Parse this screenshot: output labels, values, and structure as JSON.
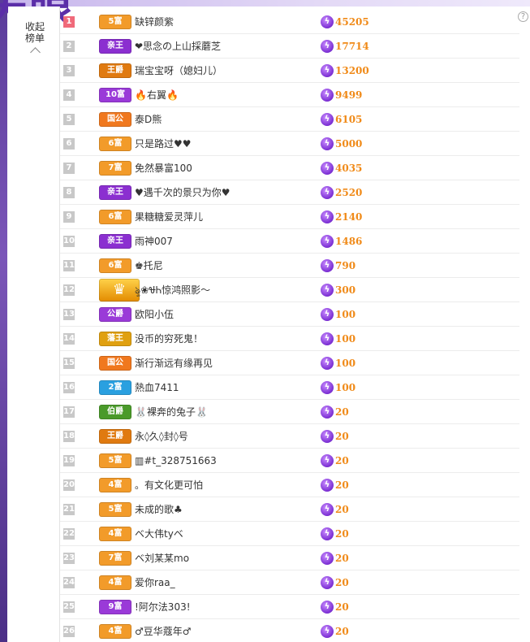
{
  "sidebar": {
    "collapse_label_line1": "收起",
    "collapse_label_line2": "榜单"
  },
  "help_icon": "?",
  "bolt_glyph": "ϟ",
  "brand_glyph": "天眼",
  "rows": [
    {
      "rank": "1",
      "badge": "5富",
      "badge_color": "#f29b2a",
      "name": "缺锌颜紫",
      "value": "45205"
    },
    {
      "rank": "2",
      "badge": "亲王",
      "badge_color": "#8b2fd0",
      "name": "❤思念の上山採蘑芝",
      "value": "17714"
    },
    {
      "rank": "3",
      "badge": "王爵",
      "badge_color": "#e07a10",
      "name": "瑞宝宝呀（媳妇儿）",
      "value": "13200"
    },
    {
      "rank": "4",
      "badge": "10富",
      "badge_color": "#9a3ad8",
      "name": "🔥右翼🔥",
      "value": "9499"
    },
    {
      "rank": "5",
      "badge": "国公",
      "badge_color": "#f0781e",
      "name": "泰D熊",
      "value": "6105"
    },
    {
      "rank": "6",
      "badge": "6富",
      "badge_color": "#f29b2a",
      "name": "只是路过♥♥",
      "value": "5000"
    },
    {
      "rank": "7",
      "badge": "7富",
      "badge_color": "#f29b2a",
      "name": "免然暴富100",
      "value": "4035"
    },
    {
      "rank": "8",
      "badge": "亲王",
      "badge_color": "#8b2fd0",
      "name": "♥遇千次的景只为你♥",
      "value": "2520"
    },
    {
      "rank": "9",
      "badge": "6富",
      "badge_color": "#f29b2a",
      "name": "果糖糖爱灵萍儿",
      "value": "2140"
    },
    {
      "rank": "10",
      "badge": "亲王",
      "badge_color": "#8b2fd0",
      "name": "雨神007",
      "value": "1486"
    },
    {
      "rank": "11",
      "badge": "6富",
      "badge_color": "#f29b2a",
      "name": "♚托尼",
      "value": "790"
    },
    {
      "rank": "12",
      "badge": "",
      "badge_color": "#f0a020",
      "name": "ৡ❀ᏠᏂ惊鸿照影～",
      "value": "300"
    },
    {
      "rank": "13",
      "badge": "公爵",
      "badge_color": "#9a3ad8",
      "name": "欧阳小伍",
      "value": "100"
    },
    {
      "rank": "14",
      "badge": "藩王",
      "badge_color": "#e0a010",
      "name": "没币的穷死鬼！",
      "value": "100"
    },
    {
      "rank": "15",
      "badge": "国公",
      "badge_color": "#f0781e",
      "name": "渐行渐远有缘再见",
      "value": "100"
    },
    {
      "rank": "16",
      "badge": "2富",
      "badge_color": "#2aa0e0",
      "name": "熱血7411",
      "value": "100"
    },
    {
      "rank": "17",
      "badge": "伯爵",
      "badge_color": "#4a9a2a",
      "name": "🐰裸奔的兔子🐰",
      "value": "20"
    },
    {
      "rank": "18",
      "badge": "王爵",
      "badge_color": "#e07a10",
      "name": "永◊久◊封◊号",
      "value": "20"
    },
    {
      "rank": "19",
      "badge": "5富",
      "badge_color": "#f29b2a",
      "name": "▥#t_328751663",
      "value": "20"
    },
    {
      "rank": "20",
      "badge": "4富",
      "badge_color": "#f29b2a",
      "name": "。有文化更可怕",
      "value": "20"
    },
    {
      "rank": "21",
      "badge": "5富",
      "badge_color": "#f29b2a",
      "name": "未成的歌♣",
      "value": "20"
    },
    {
      "rank": "22",
      "badge": "4富",
      "badge_color": "#f29b2a",
      "name": "ベ大伟tyベ",
      "value": "20"
    },
    {
      "rank": "23",
      "badge": "7富",
      "badge_color": "#f29b2a",
      "name": "ベ刘某某mo",
      "value": "20"
    },
    {
      "rank": "24",
      "badge": "4富",
      "badge_color": "#f29b2a",
      "name": "爱你raa_",
      "value": "20"
    },
    {
      "rank": "25",
      "badge": "9富",
      "badge_color": "#9a3ad8",
      "name": "!阿尔法303!",
      "value": "20"
    },
    {
      "rank": "26",
      "badge": "4富",
      "badge_color": "#f29b2a",
      "name": "♂豆华蔻年♂",
      "value": "20"
    }
  ]
}
